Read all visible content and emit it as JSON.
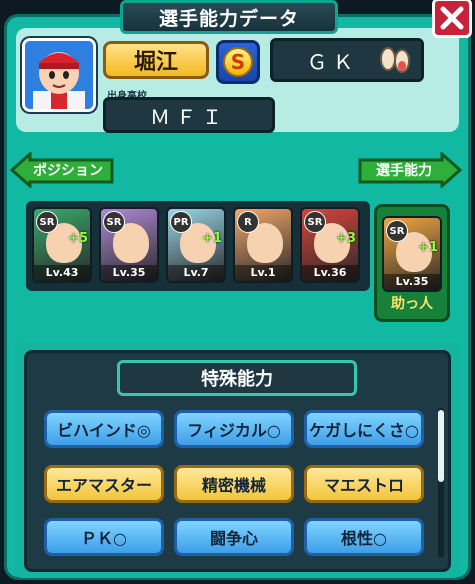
{
  "header": {
    "title": "選手能力データ"
  },
  "player": {
    "name": "堀江",
    "rank": "S",
    "position": "ＧＫ",
    "school_label": "出身高校",
    "school": "ＭＦＩ"
  },
  "nav": {
    "left_label": "ポジション",
    "right_label": "選手能力"
  },
  "cards": [
    {
      "rarity": "SR",
      "level": "Lv.43",
      "plus": "+5",
      "color": "#3aa86b"
    },
    {
      "rarity": "SR",
      "level": "Lv.35",
      "plus": "",
      "color": "#b08ad6"
    },
    {
      "rarity": "PR",
      "level": "Lv.7",
      "plus": "+1",
      "color": "#9ad6e8"
    },
    {
      "rarity": "R",
      "level": "Lv.1",
      "plus": "",
      "color": "#f3a76a"
    },
    {
      "rarity": "SR",
      "level": "Lv.36",
      "plus": "+3",
      "color": "#d8443a"
    }
  ],
  "helper": {
    "card": {
      "rarity": "SR",
      "level": "Lv.35",
      "plus": "+1",
      "color": "#f0a640"
    },
    "label": "助っ人"
  },
  "abilities": {
    "title": "特殊能力",
    "items": [
      {
        "label": "ビハインド◎",
        "style": "blue"
      },
      {
        "label": "フィジカル○",
        "style": "blue"
      },
      {
        "label": "ケガしにくさ○",
        "style": "blue"
      },
      {
        "label": "エアマスター",
        "style": "gold"
      },
      {
        "label": "精密機械",
        "style": "gold"
      },
      {
        "label": "マエストロ",
        "style": "gold"
      },
      {
        "label": "ＰＫ○",
        "style": "blue"
      },
      {
        "label": "闘争心",
        "style": "blue"
      },
      {
        "label": "根性○",
        "style": "blue"
      }
    ]
  },
  "colors": {
    "frame": "#12b9a2",
    "panel": "#b7ece4",
    "dark": "#1e3740",
    "close": "#c8223a"
  }
}
